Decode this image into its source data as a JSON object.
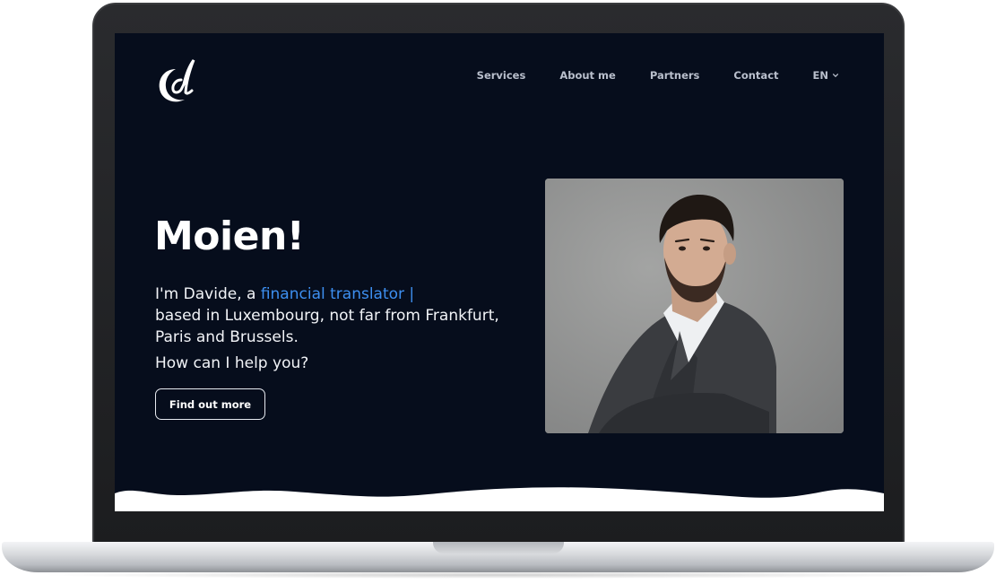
{
  "site": {
    "logo_icon": "cd-monogram-logo",
    "nav": {
      "items": [
        "Services",
        "About me",
        "Partners",
        "Contact"
      ],
      "language": "EN"
    },
    "hero": {
      "title": "Moien!",
      "intro_prefix": "I'm Davide, a ",
      "intro_highlight": "financial translator |",
      "intro_suffix": "based in Luxembourg, not far from Frankfurt, Paris and Brussels.",
      "question": "How can I help you?",
      "cta_label": "Find out more",
      "photo_subject": "portrait-photo"
    },
    "colors": {
      "background": "#060d1c",
      "accent": "#3d8ff0",
      "text": "#f1f3f7",
      "nav_text": "#b9bfcc"
    }
  }
}
